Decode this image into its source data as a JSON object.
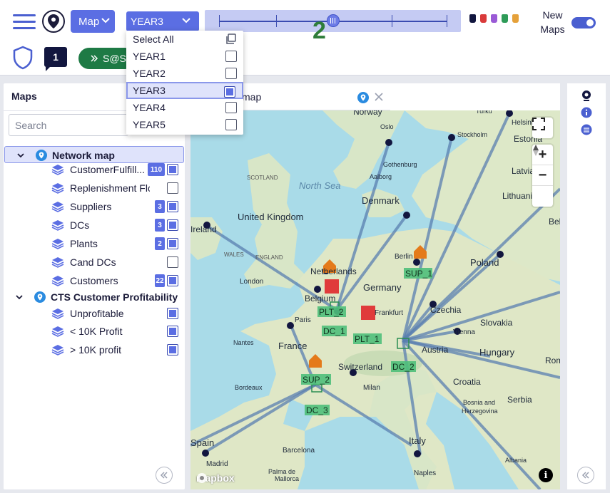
{
  "header": {
    "map_button_label": "Map",
    "year_selector_value": "YEAR3",
    "new_maps_label": "New\nMaps",
    "new_maps_enabled": true,
    "scenario_count": "1",
    "scenario_pill_label": "S@S",
    "timeline_position_fraction": 0.5,
    "annotations": [
      "1",
      "2"
    ],
    "accent_color": "#5b6ee3"
  },
  "year_dropdown": {
    "select_all_label": "Select All",
    "options": [
      {
        "label": "YEAR1",
        "checked": false
      },
      {
        "label": "YEAR2",
        "checked": false
      },
      {
        "label": "YEAR3",
        "checked": true
      },
      {
        "label": "YEAR4",
        "checked": false
      },
      {
        "label": "YEAR5",
        "checked": false
      }
    ]
  },
  "left_panel": {
    "title": "Maps",
    "search_placeholder": "Search",
    "groups": [
      {
        "label": "Network map",
        "active": true,
        "layers": [
          {
            "label": "CustomerFulfill...",
            "badge": "110",
            "checked": true
          },
          {
            "label": "Replenishment Flow",
            "badge": "",
            "checked": false
          },
          {
            "label": "Suppliers",
            "badge": "3",
            "checked": true
          },
          {
            "label": "DCs",
            "badge": "3",
            "checked": true
          },
          {
            "label": "Plants",
            "badge": "2",
            "checked": true
          },
          {
            "label": "Cand DCs",
            "badge": "",
            "checked": false
          },
          {
            "label": "Customers",
            "badge": "22",
            "checked": true
          }
        ]
      },
      {
        "label": "CTS Customer Profitability",
        "active": false,
        "layers": [
          {
            "label": "Unprofitable",
            "badge": "",
            "checked": true
          },
          {
            "label": "< 10K Profit",
            "badge": "",
            "checked": true
          },
          {
            "label": "> 10K profit",
            "badge": "",
            "checked": true
          }
        ]
      }
    ]
  },
  "map_panel": {
    "tab_title": "map",
    "attribution": "mapbox",
    "labels": {
      "countries": [
        "Norway",
        "Estonia",
        "Latvia",
        "Lithuania",
        "Denmark",
        "United Kingdom",
        "Netherlands",
        "Belgium",
        "Germany",
        "Poland",
        "Czechia",
        "Slovakia",
        "Hungary",
        "Austria",
        "France",
        "Switzerland",
        "Italy",
        "Croatia",
        "Serbia",
        "Bosnia and Herzegovina",
        "Albania",
        "Spain",
        "Ireland",
        "Belarus",
        "Romania"
      ],
      "seas": [
        "North Sea"
      ],
      "cities": [
        "Oslo",
        "Stockholm",
        "Helsinki",
        "Turku",
        "Gothenburg",
        "Aalborg",
        "London",
        "Paris",
        "Berlin",
        "Frankfurt",
        "Vienna",
        "Milan",
        "Nantes",
        "Bordeaux",
        "Madrid",
        "Barcelona",
        "Palma de Mallorca",
        "Naples",
        "Scotland",
        "Wales",
        "England"
      ],
      "facilities": [
        "SUP_1",
        "SUP_2",
        "PLT_1",
        "PLT_2",
        "DC_1",
        "DC_2",
        "DC_3"
      ]
    }
  }
}
